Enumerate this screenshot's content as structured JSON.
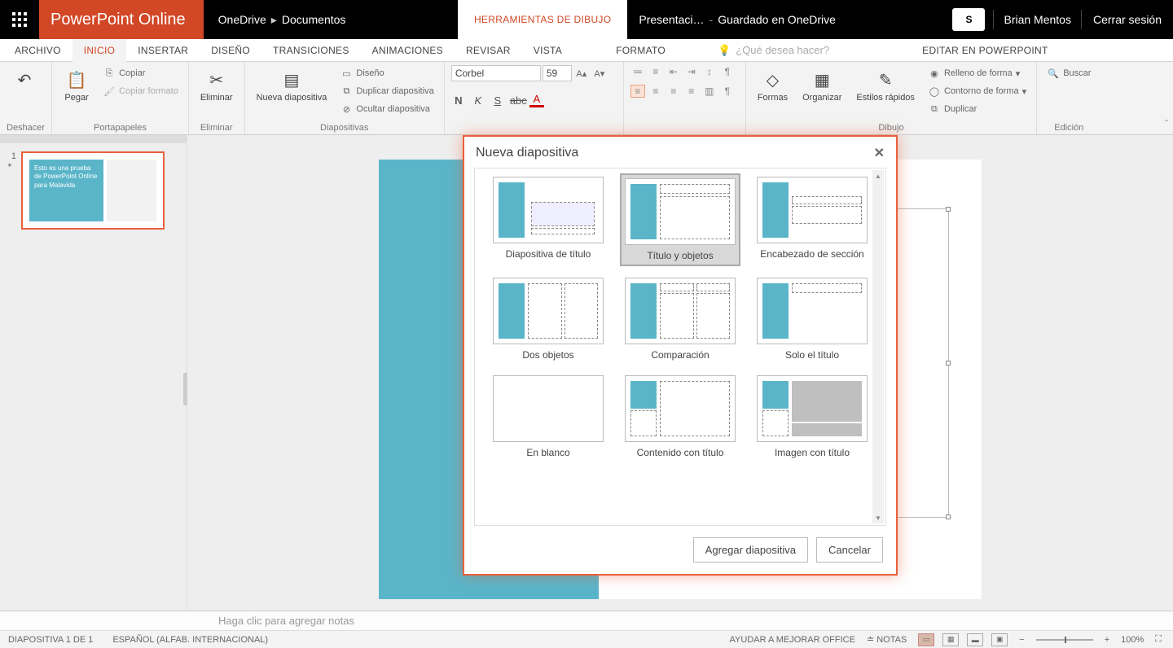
{
  "title": {
    "app": "PowerPoint Online",
    "bc1": "OneDrive",
    "bc2": "Documentos",
    "toolsTab": "HERRAMIENTAS DE DIBUJO",
    "docName": "Presentaci…",
    "saved": "Guardado en OneDrive",
    "user": "Brian Mentos",
    "signout": "Cerrar sesión"
  },
  "tabs": {
    "archivo": "ARCHIVO",
    "inicio": "INICIO",
    "insertar": "INSERTAR",
    "diseno": "DISEÑO",
    "transiciones": "TRANSICIONES",
    "animaciones": "ANIMACIONES",
    "revisar": "REVISAR",
    "vista": "VISTA",
    "formato": "FORMATO",
    "tellme": "¿Qué desea hacer?",
    "editpp": "EDITAR EN POWERPOINT"
  },
  "ribbon": {
    "deshacer": "Deshacer",
    "pegar": "Pegar",
    "copiar": "Copiar",
    "copiarFormato": "Copiar formato",
    "portapapeles": "Portapapeles",
    "eliminar": "Eliminar",
    "eliminarGrp": "Eliminar",
    "nuevaDiap": "Nueva diapositiva",
    "disenoBtn": "Diseño",
    "duplicar": "Duplicar diapositiva",
    "ocultar": "Ocultar diapositiva",
    "diapositivas": "Diapositivas",
    "fontName": "Corbel",
    "fontSize": "59",
    "formas": "Formas",
    "organizar": "Organizar",
    "estilos": "Estilos rápidos",
    "relleno": "Relleno de forma",
    "contorno": "Contorno de forma",
    "duplicarShape": "Duplicar",
    "dibujo": "Dibujo",
    "buscar": "Buscar",
    "edicion": "Edición"
  },
  "panel": {
    "num": "1",
    "thumbText": "Esto es una prueba de PowerPoint Online para Malavida"
  },
  "dialog": {
    "title": "Nueva diapositiva",
    "layouts": [
      "Diapositiva de título",
      "Título y objetos",
      "Encabezado de sección",
      "Dos objetos",
      "Comparación",
      "Solo el título",
      "En blanco",
      "Contenido con título",
      "Imagen con título"
    ],
    "add": "Agregar diapositiva",
    "cancel": "Cancelar"
  },
  "notes": {
    "placeholder": "Haga clic para agregar notas"
  },
  "status": {
    "slide": "DIAPOSITIVA 1 DE 1",
    "lang": "ESPAÑOL (ALFAB. INTERNACIONAL)",
    "help": "AYUDAR A MEJORAR OFFICE",
    "notas": "NOTAS",
    "zoom": "100%"
  }
}
